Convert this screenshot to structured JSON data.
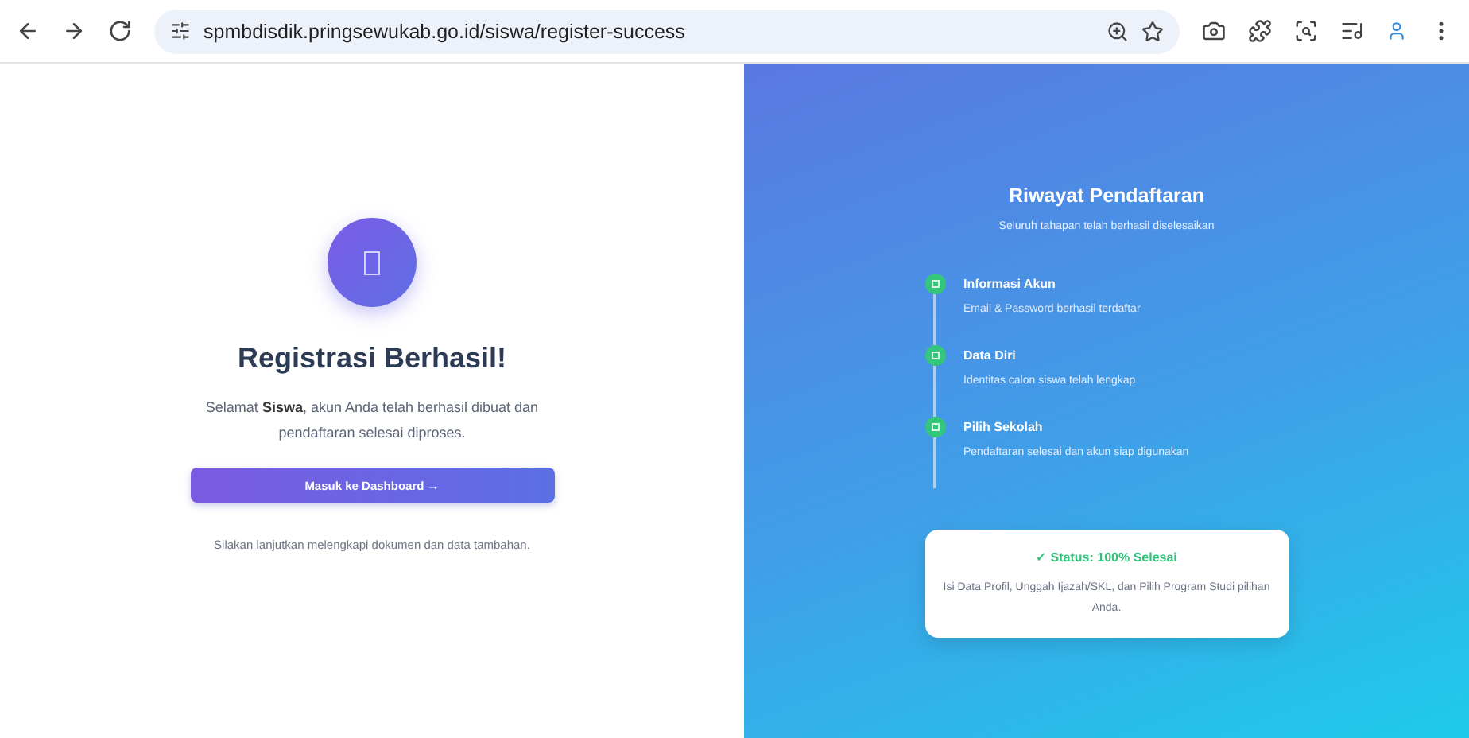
{
  "browser": {
    "url": "spmbdisdik.pringsewukab.go.id/siswa/register-success"
  },
  "success": {
    "title": "Registrasi Berhasil!",
    "message": "Selamat **Siswa**, akun Anda telah berhasil dibuat dan pendaftaran selesai diproses.",
    "button": "Masuk ke Dashboard →",
    "note": "Silakan lanjutkan melengkapi dokumen dan data tambahan."
  },
  "history": {
    "title": "Riwayat Pendaftaran",
    "subtitle": "Seluruh tahapan telah berhasil diselesaikan",
    "steps": [
      {
        "title": "Informasi Akun",
        "description": "Email & Password berhasil terdaftar",
        "done": true
      },
      {
        "title": "Data Diri",
        "description": "Identitas calon siswa telah lengkap",
        "done": true
      },
      {
        "title": "Pilih Sekolah",
        "description": "Pendaftaran selesai dan akun siap digunakan",
        "done": true
      }
    ],
    "status": {
      "title": "✓ Status: 100% Selesai",
      "description": "Isi Data Profil, Unggah Ijazah/SKL, dan Pilih Program Studi pilihan Anda."
    }
  }
}
